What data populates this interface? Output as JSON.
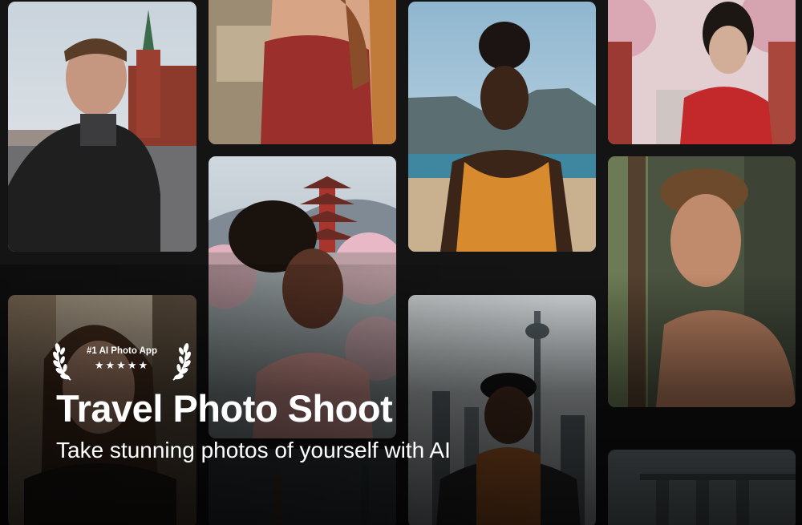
{
  "badge": {
    "label": "#1 AI Photo App",
    "stars": "★★★★★",
    "icons": [
      "laurel-left-icon",
      "laurel-right-icon"
    ]
  },
  "hero": {
    "title": "Travel Photo Shoot",
    "subtitle": "Take stunning photos of yourself with AI"
  },
  "colors": {
    "background": "#141414",
    "text": "#ffffff"
  }
}
